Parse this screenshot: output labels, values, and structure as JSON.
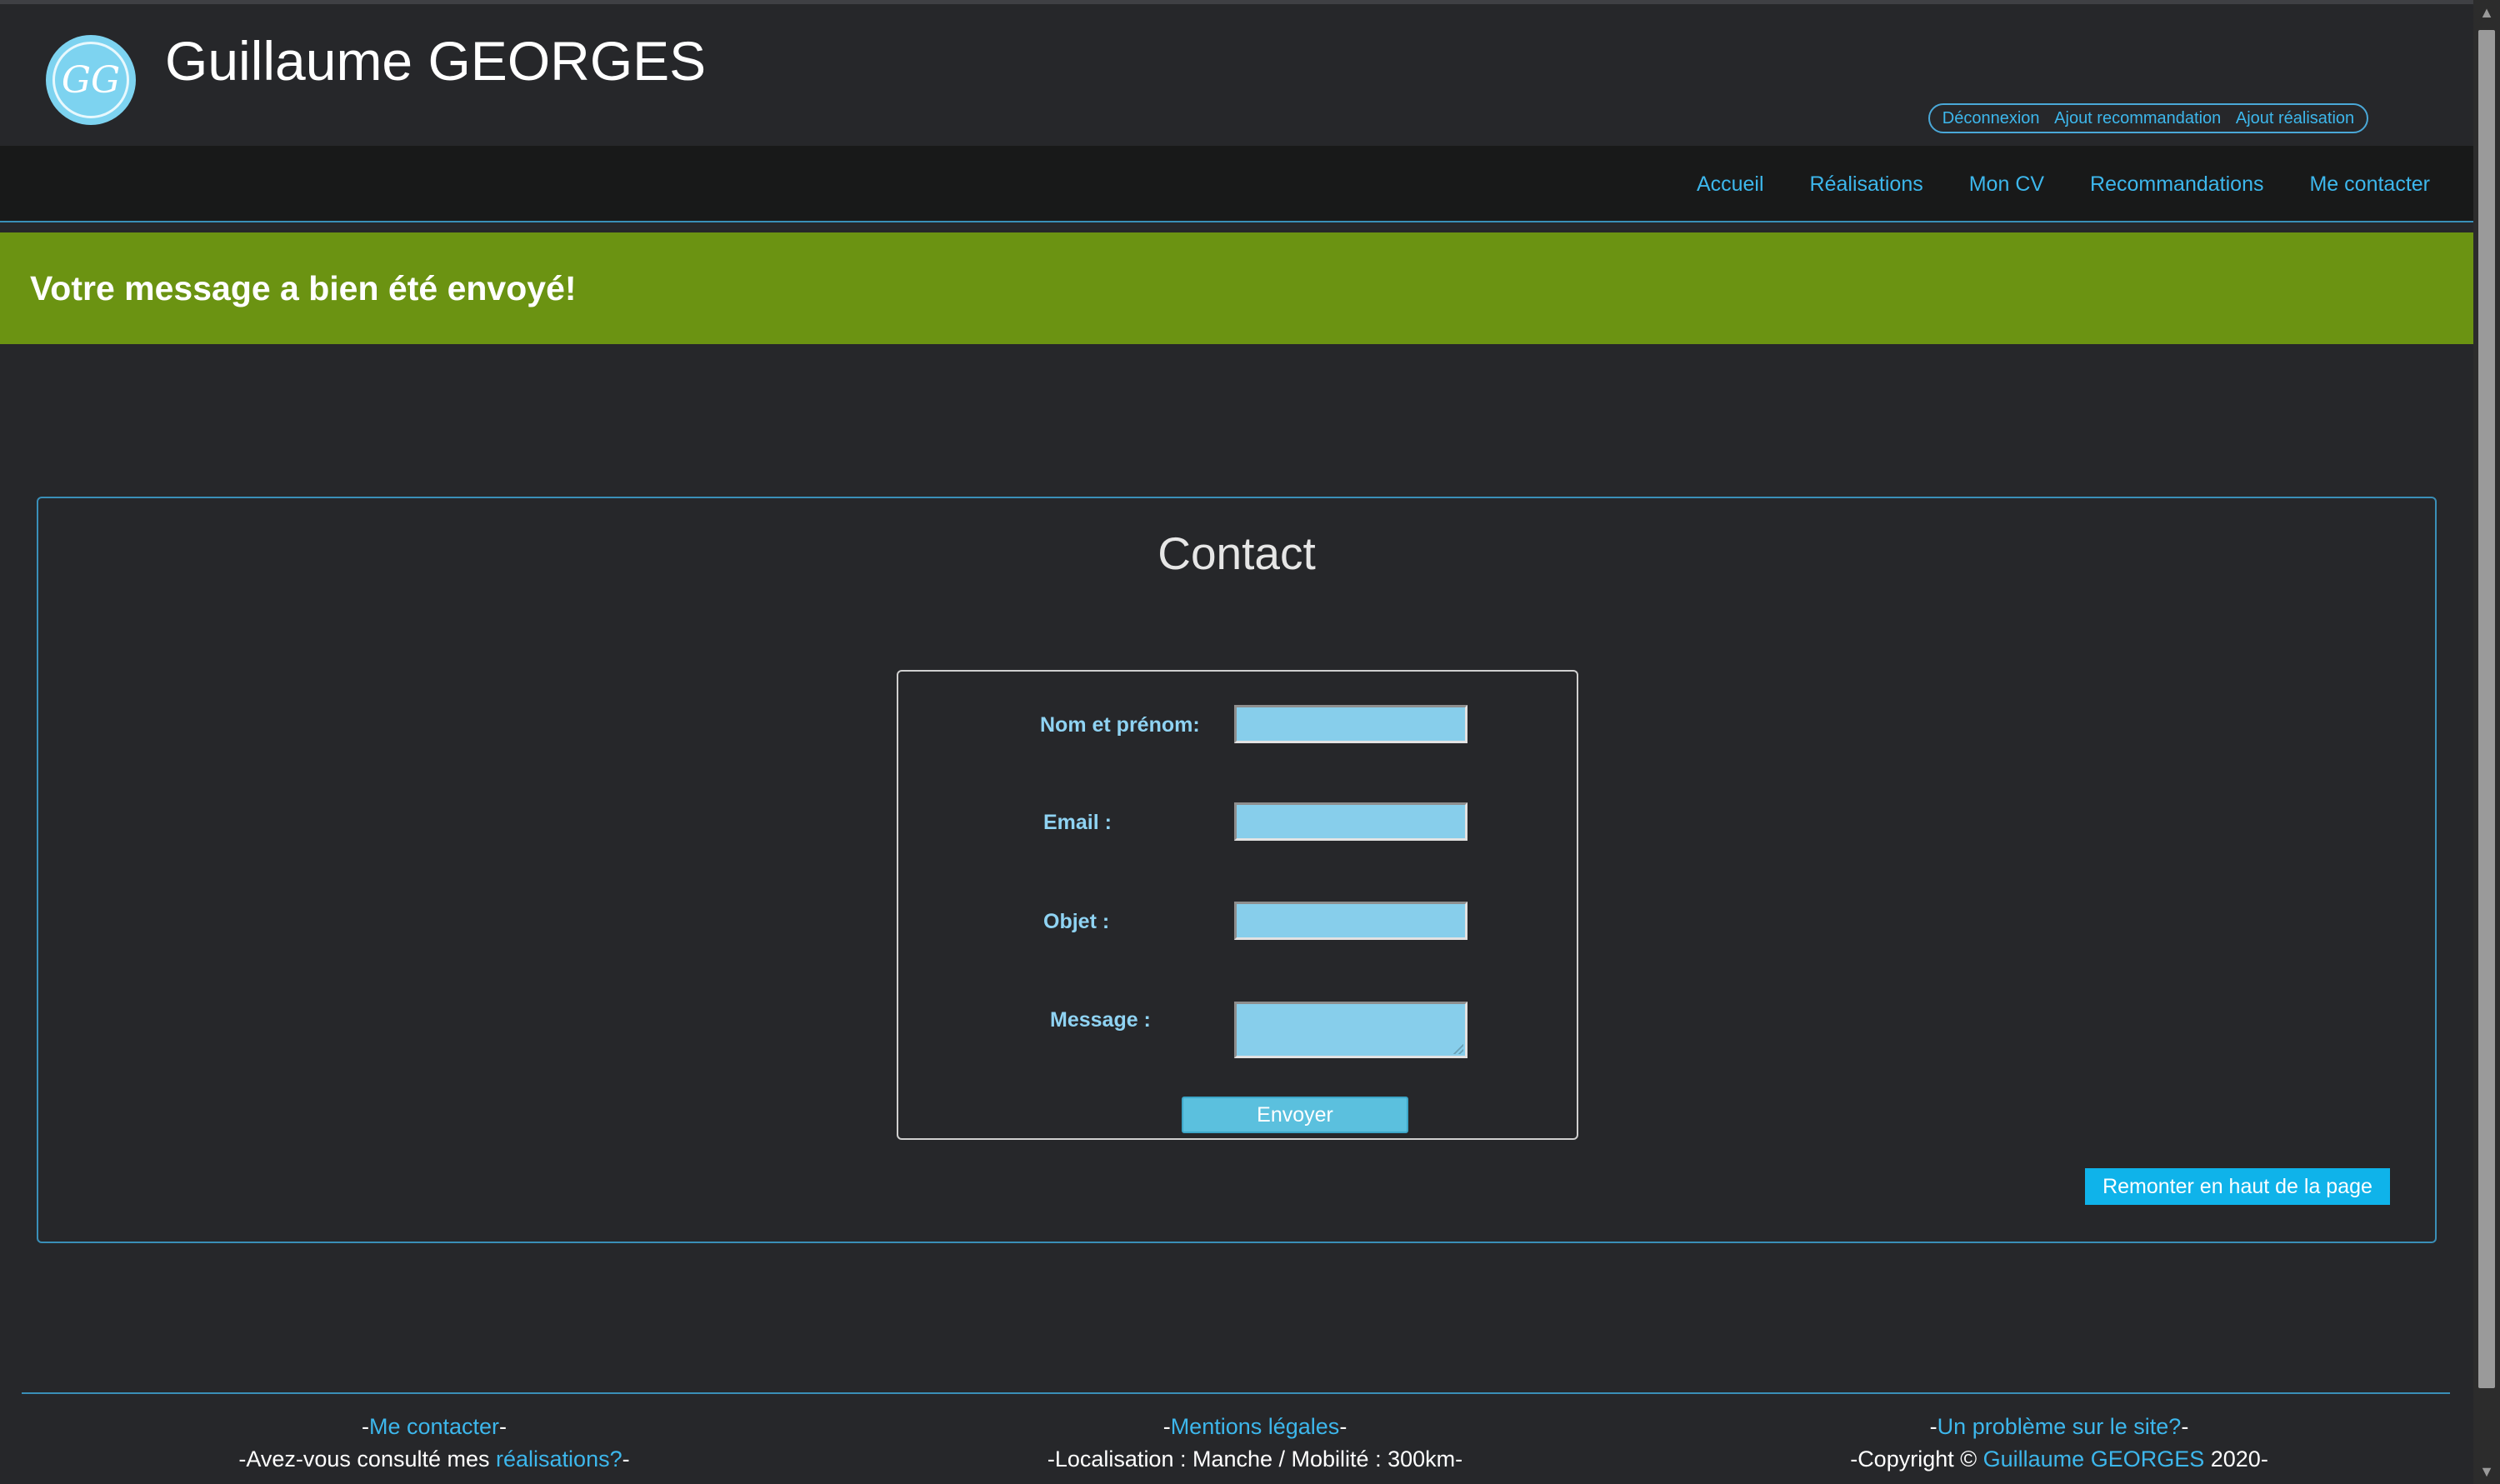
{
  "header": {
    "logo_text": "GG",
    "title": "Guillaume GEORGES",
    "admin_links": [
      "Déconnexion",
      "Ajout recommandation",
      "Ajout réalisation"
    ]
  },
  "nav": {
    "items": [
      "Accueil",
      "Réalisations",
      "Mon CV",
      "Recommandations",
      "Me contacter"
    ]
  },
  "banner": {
    "message": "Votre message a bien été envoyé!"
  },
  "contact": {
    "title": "Contact",
    "fields": [
      {
        "label": "Nom et prénom:",
        "value": ""
      },
      {
        "label": "Email :",
        "value": ""
      },
      {
        "label": "Objet :",
        "value": ""
      },
      {
        "label": "Message :",
        "value": ""
      }
    ],
    "submit_label": "Envoyer",
    "back_to_top_label": "Remonter en haut de la page"
  },
  "footer": {
    "col1_link": "Me contacter",
    "col1_text": "Avez-vous consulté mes ",
    "col1_text_link": "réalisations?",
    "col2_link": "Mentions légales",
    "col2_text": "Localisation : Manche / Mobilité : 300km",
    "col3_link": "Un problème sur le site?",
    "col3_text_pre": "Copyright © ",
    "col3_text_link": "Guillaume GEORGES",
    "col3_text_post": " 2020"
  },
  "colors": {
    "background": "#26272a",
    "accent": "#3db7ec",
    "success": "#6b9312",
    "input": "#87ceeb"
  }
}
